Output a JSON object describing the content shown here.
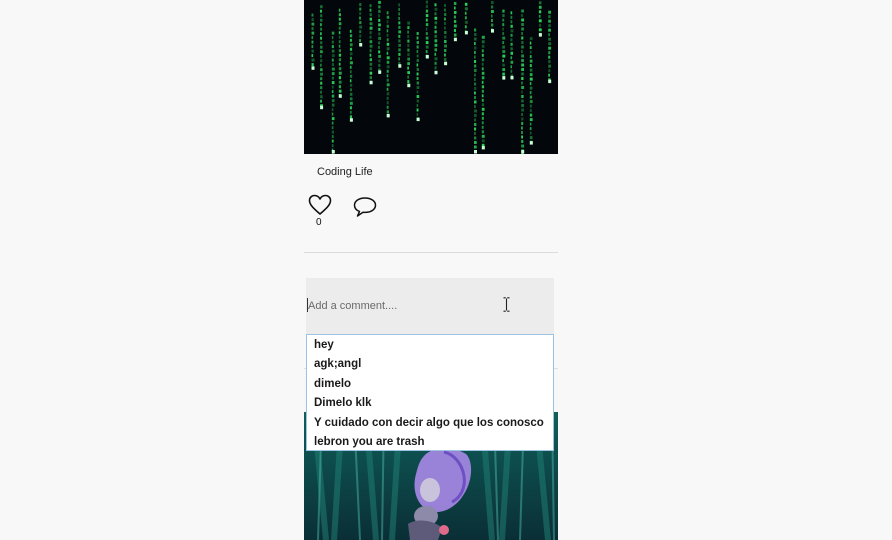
{
  "post": {
    "caption": "Coding Life",
    "like_count": "0",
    "image": "matrix-code-rain"
  },
  "comment_box": {
    "placeholder": "Add a comment....",
    "value": ""
  },
  "autocomplete": {
    "suggestions": [
      "hey",
      "agk;angl",
      "dimelo",
      "Dimelo klk",
      "Y cuidado con decir algo que los conosco",
      "lebron you are trash"
    ]
  },
  "next_post": {
    "image": "animated-purple-character-forest"
  },
  "icons": {
    "like": "heart-icon",
    "comment": "speech-bubble-icon",
    "cursor": "i-beam-cursor-icon"
  },
  "colors": {
    "matrix_green": "#2bd45a",
    "dropdown_border": "#9cc2e4",
    "input_bg": "#ececec"
  }
}
